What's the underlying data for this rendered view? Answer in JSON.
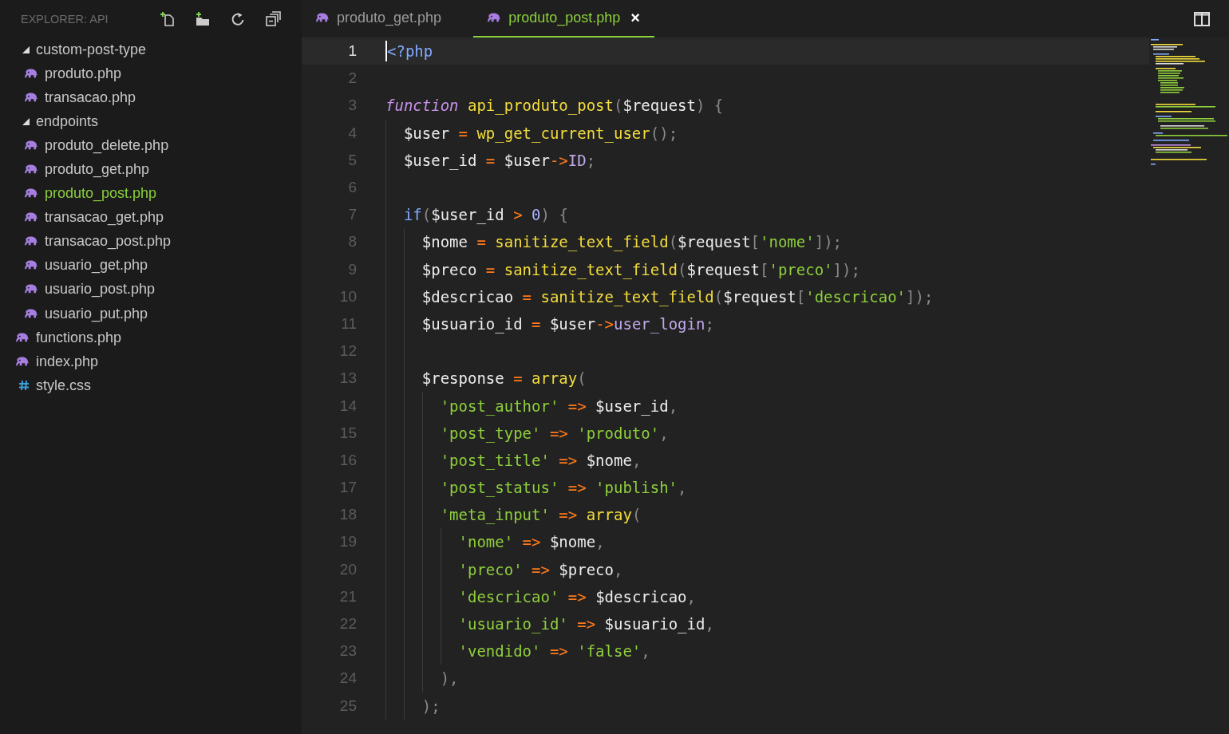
{
  "sidebar": {
    "title": "EXPLORER: API",
    "tree": [
      {
        "label": "custom-post-type",
        "kind": "folder",
        "expanded": true,
        "selected": false,
        "children": [
          {
            "label": "produto.php",
            "kind": "php",
            "selected": false
          },
          {
            "label": "transacao.php",
            "kind": "php",
            "selected": false
          }
        ]
      },
      {
        "label": "endpoints",
        "kind": "folder",
        "expanded": true,
        "selected": false,
        "children": [
          {
            "label": "produto_delete.php",
            "kind": "php",
            "selected": false
          },
          {
            "label": "produto_get.php",
            "kind": "php",
            "selected": false
          },
          {
            "label": "produto_post.php",
            "kind": "php",
            "selected": true
          },
          {
            "label": "transacao_get.php",
            "kind": "php",
            "selected": false
          },
          {
            "label": "transacao_post.php",
            "kind": "php",
            "selected": false
          },
          {
            "label": "usuario_get.php",
            "kind": "php",
            "selected": false
          },
          {
            "label": "usuario_post.php",
            "kind": "php",
            "selected": false
          },
          {
            "label": "usuario_put.php",
            "kind": "php",
            "selected": false
          }
        ]
      },
      {
        "label": "functions.php",
        "kind": "php",
        "selected": false
      },
      {
        "label": "index.php",
        "kind": "php",
        "selected": false
      },
      {
        "label": "style.css",
        "kind": "css",
        "selected": false
      }
    ]
  },
  "tabs": [
    {
      "label": "produto_get.php",
      "kind": "php",
      "selected": false
    },
    {
      "label": "produto_post.php",
      "kind": "php",
      "selected": true,
      "close": "×"
    }
  ],
  "lines": [
    {
      "number": "1",
      "current": true,
      "tokens": [
        {
          "kind": "tag",
          "text": "<?php"
        }
      ]
    },
    {
      "number": "2",
      "current": false
    },
    {
      "number": "3",
      "current": false,
      "tokens": [
        {
          "kind": "keyword",
          "text": "function"
        },
        {
          "kind": "func",
          "text": " api_produto_post"
        },
        {
          "kind": "punc",
          "text": "("
        },
        {
          "kind": "var",
          "text": "$request"
        },
        {
          "kind": "punc",
          "text": ") {"
        }
      ],
      "children": [
        {
          "number": "4",
          "current": false,
          "tokens": [
            {
              "kind": "var",
              "text": "$user"
            },
            {
              "kind": "op",
              "text": " ="
            },
            {
              "kind": "func",
              "text": " wp_get_current_user"
            },
            {
              "kind": "punc",
              "text": "();"
            }
          ]
        },
        {
          "number": "5",
          "current": false,
          "tokens": [
            {
              "kind": "var",
              "text": "$user_id"
            },
            {
              "kind": "op",
              "text": " ="
            },
            {
              "kind": "var",
              "text": " $user"
            },
            {
              "kind": "op",
              "text": "->"
            },
            {
              "kind": "member",
              "text": "ID"
            },
            {
              "kind": "punc",
              "text": ";"
            }
          ]
        },
        {
          "number": "6",
          "current": false
        },
        {
          "number": "7",
          "current": false,
          "tokens": [
            {
              "kind": "control",
              "text": "if"
            },
            {
              "kind": "punc",
              "text": "("
            },
            {
              "kind": "var",
              "text": "$user_id"
            },
            {
              "kind": "op",
              "text": " >"
            },
            {
              "kind": "num",
              "text": " 0"
            },
            {
              "kind": "punc",
              "text": ") {"
            }
          ],
          "children": [
            {
              "number": "8",
              "current": false,
              "tokens": [
                {
                  "kind": "var",
                  "text": "$nome"
                },
                {
                  "kind": "op",
                  "text": " ="
                },
                {
                  "kind": "func",
                  "text": " sanitize_text_field"
                },
                {
                  "kind": "punc",
                  "text": "("
                },
                {
                  "kind": "var",
                  "text": "$request"
                },
                {
                  "kind": "punc",
                  "text": "["
                },
                {
                  "kind": "str",
                  "text": "'nome'"
                },
                {
                  "kind": "punc",
                  "text": "]);"
                }
              ]
            },
            {
              "number": "9",
              "current": false,
              "tokens": [
                {
                  "kind": "var",
                  "text": "$preco"
                },
                {
                  "kind": "op",
                  "text": " ="
                },
                {
                  "kind": "func",
                  "text": " sanitize_text_field"
                },
                {
                  "kind": "punc",
                  "text": "("
                },
                {
                  "kind": "var",
                  "text": "$request"
                },
                {
                  "kind": "punc",
                  "text": "["
                },
                {
                  "kind": "str",
                  "text": "'preco'"
                },
                {
                  "kind": "punc",
                  "text": "]);"
                }
              ]
            },
            {
              "number": "10",
              "current": false,
              "tokens": [
                {
                  "kind": "var",
                  "text": "$descricao"
                },
                {
                  "kind": "op",
                  "text": " ="
                },
                {
                  "kind": "func",
                  "text": " sanitize_text_field"
                },
                {
                  "kind": "punc",
                  "text": "("
                },
                {
                  "kind": "var",
                  "text": "$request"
                },
                {
                  "kind": "punc",
                  "text": "["
                },
                {
                  "kind": "str",
                  "text": "'descricao'"
                },
                {
                  "kind": "punc",
                  "text": "]);"
                }
              ]
            },
            {
              "number": "11",
              "current": false,
              "tokens": [
                {
                  "kind": "var",
                  "text": "$usuario_id"
                },
                {
                  "kind": "op",
                  "text": " ="
                },
                {
                  "kind": "var",
                  "text": " $user"
                },
                {
                  "kind": "op",
                  "text": "->"
                },
                {
                  "kind": "member",
                  "text": "user_login"
                },
                {
                  "kind": "punc",
                  "text": ";"
                }
              ]
            },
            {
              "number": "12",
              "current": false
            },
            {
              "number": "13",
              "current": false,
              "tokens": [
                {
                  "kind": "var",
                  "text": "$response"
                },
                {
                  "kind": "op",
                  "text": " ="
                },
                {
                  "kind": "func",
                  "text": " array"
                },
                {
                  "kind": "punc",
                  "text": "("
                }
              ],
              "children": [
                {
                  "number": "14",
                  "current": false,
                  "tokens": [
                    {
                      "kind": "str",
                      "text": "'post_author'"
                    },
                    {
                      "kind": "op",
                      "text": " =>"
                    },
                    {
                      "kind": "var",
                      "text": " $user_id"
                    },
                    {
                      "kind": "punc",
                      "text": ","
                    }
                  ]
                },
                {
                  "number": "15",
                  "current": false,
                  "tokens": [
                    {
                      "kind": "str",
                      "text": "'post_type'"
                    },
                    {
                      "kind": "op",
                      "text": " =>"
                    },
                    {
                      "kind": "str",
                      "text": " 'produto'"
                    },
                    {
                      "kind": "punc",
                      "text": ","
                    }
                  ]
                },
                {
                  "number": "16",
                  "current": false,
                  "tokens": [
                    {
                      "kind": "str",
                      "text": "'post_title'"
                    },
                    {
                      "kind": "op",
                      "text": " =>"
                    },
                    {
                      "kind": "var",
                      "text": " $nome"
                    },
                    {
                      "kind": "punc",
                      "text": ","
                    }
                  ]
                },
                {
                  "number": "17",
                  "current": false,
                  "tokens": [
                    {
                      "kind": "str",
                      "text": "'post_status'"
                    },
                    {
                      "kind": "op",
                      "text": " =>"
                    },
                    {
                      "kind": "str",
                      "text": " 'publish'"
                    },
                    {
                      "kind": "punc",
                      "text": ","
                    }
                  ]
                },
                {
                  "number": "18",
                  "current": false,
                  "tokens": [
                    {
                      "kind": "str",
                      "text": "'meta_input'"
                    },
                    {
                      "kind": "op",
                      "text": " =>"
                    },
                    {
                      "kind": "func",
                      "text": " array"
                    },
                    {
                      "kind": "punc",
                      "text": "("
                    }
                  ],
                  "children": [
                    {
                      "number": "19",
                      "current": false,
                      "tokens": [
                        {
                          "kind": "str",
                          "text": "'nome'"
                        },
                        {
                          "kind": "op",
                          "text": " =>"
                        },
                        {
                          "kind": "var",
                          "text": " $nome"
                        },
                        {
                          "kind": "punc",
                          "text": ","
                        }
                      ]
                    },
                    {
                      "number": "20",
                      "current": false,
                      "tokens": [
                        {
                          "kind": "str",
                          "text": "'preco'"
                        },
                        {
                          "kind": "op",
                          "text": " =>"
                        },
                        {
                          "kind": "var",
                          "text": " $preco"
                        },
                        {
                          "kind": "punc",
                          "text": ","
                        }
                      ]
                    },
                    {
                      "number": "21",
                      "current": false,
                      "tokens": [
                        {
                          "kind": "str",
                          "text": "'descricao'"
                        },
                        {
                          "kind": "op",
                          "text": " =>"
                        },
                        {
                          "kind": "var",
                          "text": " $descricao"
                        },
                        {
                          "kind": "punc",
                          "text": ","
                        }
                      ]
                    },
                    {
                      "number": "22",
                      "current": false,
                      "tokens": [
                        {
                          "kind": "str",
                          "text": "'usuario_id'"
                        },
                        {
                          "kind": "op",
                          "text": " =>"
                        },
                        {
                          "kind": "var",
                          "text": " $usuario_id"
                        },
                        {
                          "kind": "punc",
                          "text": ","
                        }
                      ]
                    },
                    {
                      "number": "23",
                      "current": false,
                      "tokens": [
                        {
                          "kind": "str",
                          "text": "'vendido'"
                        },
                        {
                          "kind": "op",
                          "text": " =>"
                        },
                        {
                          "kind": "str",
                          "text": " 'false'"
                        },
                        {
                          "kind": "punc",
                          "text": ","
                        }
                      ]
                    }
                  ]
                },
                {
                  "number": "24",
                  "current": false,
                  "tokens": [
                    {
                      "kind": "punc",
                      "text": "),"
                    }
                  ]
                }
              ]
            },
            {
              "number": "25",
              "current": false,
              "tokens": [
                {
                  "kind": "punc",
                  "text": ");"
                }
              ]
            }
          ]
        }
      ]
    }
  ]
}
